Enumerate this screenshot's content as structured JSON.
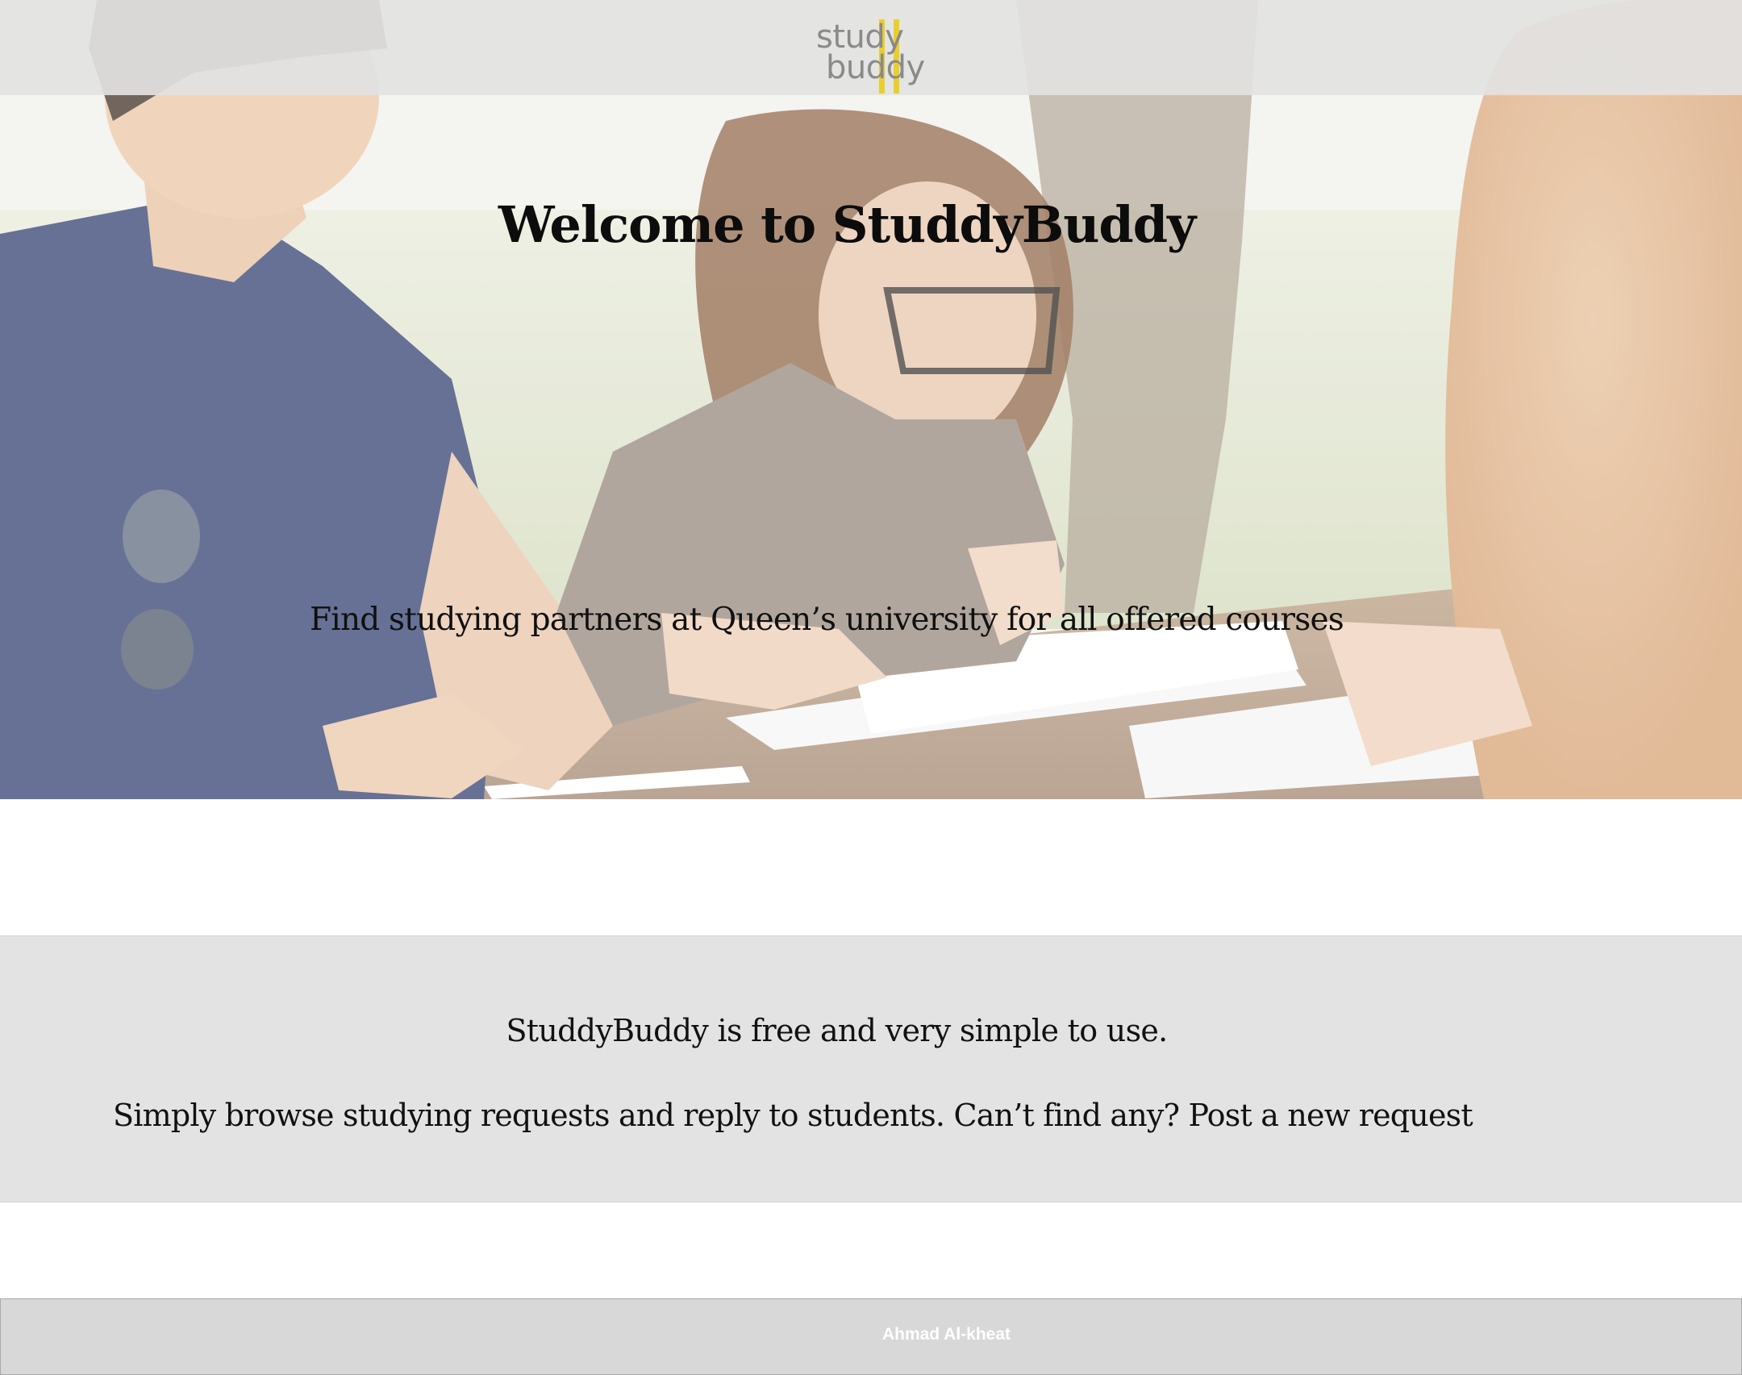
{
  "header": {
    "logo_line_1": "study",
    "logo_line_2": "buddy",
    "logo_accent_color": "#e8cf2c"
  },
  "hero": {
    "title": "Welcome to StuddyBuddy",
    "subtitle": "Find studying partners at Queen’s university for all offered courses",
    "background": "photo of students studying at an outdoor table"
  },
  "info": {
    "line_1": "StuddyBuddy is free and very simple to use.",
    "line_2": "Simply browse studying requests and reply to students. Can’t find any? Post a new request"
  },
  "footer": {
    "author": "Ahmad Al-kheat"
  },
  "colors": {
    "header_bg": "#e2e2e2",
    "info_bg": "#e3e3e3",
    "footer_bg": "#d8d8d8",
    "text": "#111111"
  }
}
